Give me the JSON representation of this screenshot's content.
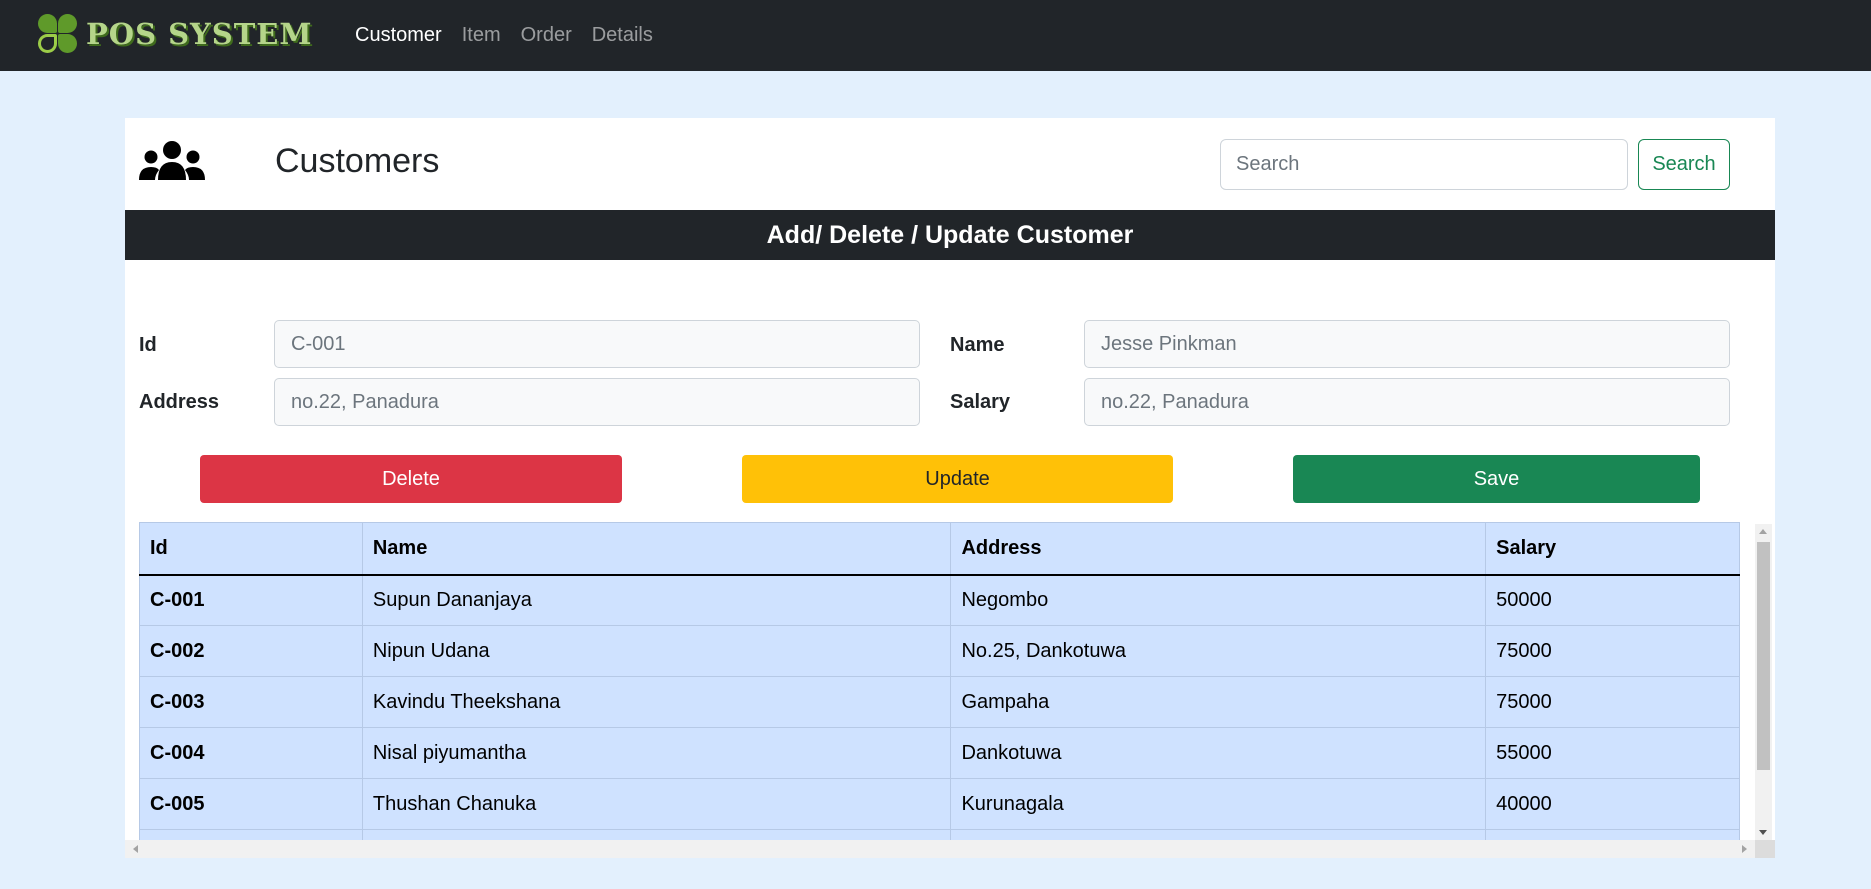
{
  "brand": {
    "text": "POS SYSTEM",
    "logo_icon": "clover-icon"
  },
  "nav": {
    "items": [
      {
        "label": "Customer",
        "active": true
      },
      {
        "label": "Item",
        "active": false
      },
      {
        "label": "Order",
        "active": false
      },
      {
        "label": "Details",
        "active": false
      }
    ]
  },
  "header": {
    "icon": "users-icon",
    "title": "Customers",
    "search_placeholder": "Search",
    "search_button": "Search"
  },
  "section_title": "Add/ Delete / Update Customer",
  "form": {
    "id_label": "Id",
    "id_placeholder": "C-001",
    "name_label": "Name",
    "name_placeholder": "Jesse Pinkman",
    "address_label": "Address",
    "address_placeholder": "no.22, Panadura",
    "salary_label": "Salary",
    "salary_placeholder": "no.22, Panadura"
  },
  "actions": {
    "delete": "Delete",
    "update": "Update",
    "save": "Save"
  },
  "colors": {
    "navbar": "#212529",
    "page_bg": "#e3f0fd",
    "danger": "#dc3545",
    "warning": "#ffc107",
    "success": "#198754",
    "table_bg": "#cfe2ff"
  },
  "table": {
    "headers": [
      "Id",
      "Name",
      "Address",
      "Salary"
    ],
    "rows": [
      [
        "C-001",
        "Supun Dananjaya",
        "Negombo",
        "50000"
      ],
      [
        "C-002",
        "Nipun Udana",
        "No.25, Dankotuwa",
        "75000"
      ],
      [
        "C-003",
        "Kavindu Theekshana",
        "Gampaha",
        "75000"
      ],
      [
        "C-004",
        "Nisal piyumantha",
        "Dankotuwa",
        "55000"
      ],
      [
        "C-005",
        "Thushan Chanuka",
        "Kurunagala",
        "40000"
      ]
    ]
  }
}
